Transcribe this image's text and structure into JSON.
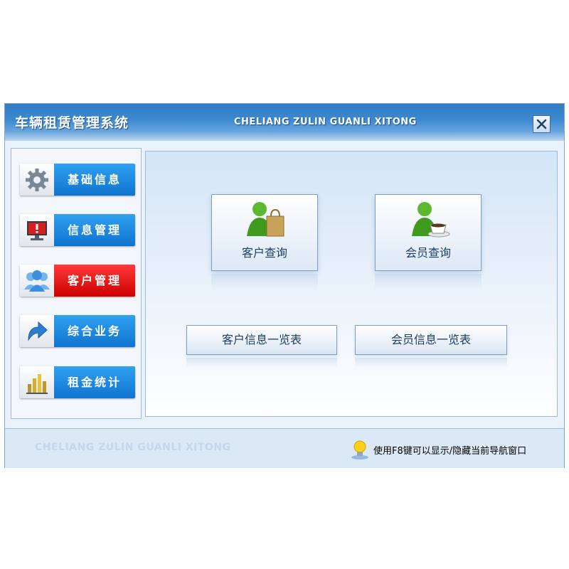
{
  "window": {
    "title": "车辆租赁管理系统",
    "subtitle": "CHELIANG ZULIN GUANLI XITONG",
    "close_icon": "close-icon"
  },
  "sidebar": {
    "items": [
      {
        "label": "基础信息",
        "icon": "gear-icon",
        "active": false
      },
      {
        "label": "信息管理",
        "icon": "monitor-alert-icon",
        "active": false
      },
      {
        "label": "客户管理",
        "icon": "users-icon",
        "active": true
      },
      {
        "label": "综合业务",
        "icon": "arrow-icon",
        "active": false
      },
      {
        "label": "租金统计",
        "icon": "bar-chart-icon",
        "active": false
      }
    ]
  },
  "main": {
    "tiles": [
      {
        "label": "客户查询",
        "icon": "user-shopping-bag-icon"
      },
      {
        "label": "会员查询",
        "icon": "user-coffee-icon"
      }
    ],
    "buttons": [
      {
        "label": "客户信息一览表"
      },
      {
        "label": "会员信息一览表"
      }
    ]
  },
  "status": {
    "watermark": "CHELIANG ZULIN GUANLI XITONG",
    "hint": "使用F8键可以显示/隐藏当前导航窗口",
    "icon": "bulb-icon"
  },
  "colors": {
    "title_bar": "#2f7cc6",
    "nav_button": "#1585de",
    "nav_active": "#e01010"
  }
}
